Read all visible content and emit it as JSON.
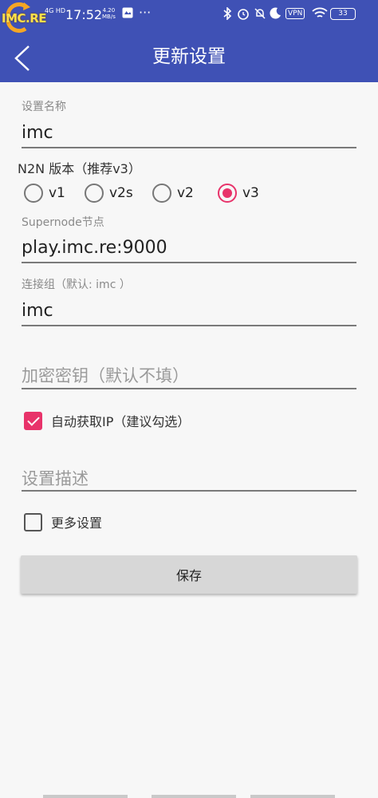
{
  "status_bar": {
    "logo_text": "IMC.RE",
    "network": "4G HD",
    "time": "17:52",
    "speed_value": "4.20",
    "speed_unit": "MB/s",
    "more": "···",
    "vpn": "VPN",
    "battery": "33"
  },
  "header": {
    "title": "更新设置",
    "color": "#3f51b5"
  },
  "form": {
    "name": {
      "label": "设置名称",
      "value": "imc"
    },
    "version": {
      "label": "N2N 版本（推荐v3）",
      "options": [
        "v1",
        "v2s",
        "v2",
        "v3"
      ],
      "selected": "v3"
    },
    "supernode": {
      "label": "Supernode节点",
      "value": "play.imc.re:9000"
    },
    "group": {
      "label": "连接组（默认: imc ）",
      "value": "imc"
    },
    "key": {
      "placeholder": "加密密钥（默认不填）"
    },
    "auto_ip": {
      "label": "自动获取IP（建议勾选）",
      "checked": true
    },
    "description": {
      "placeholder": "设置描述"
    },
    "more_settings": {
      "label": "更多设置",
      "checked": false
    },
    "save_label": "保存"
  },
  "colors": {
    "accent": "#e8336a",
    "primary": "#3f51b5"
  }
}
